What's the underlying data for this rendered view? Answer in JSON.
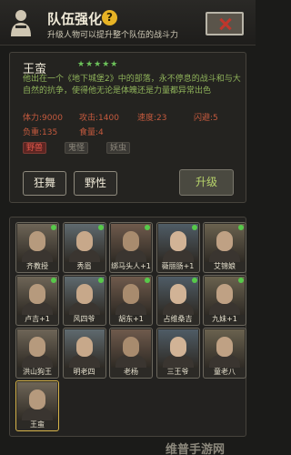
{
  "header": {
    "title": "队伍强化",
    "subtitle": "升级人物可以提升整个队伍的战斗力",
    "help": "?"
  },
  "hero": {
    "name": "王蛮",
    "stars": "★★★★★",
    "description": "他出在一个《地下城堡2》中的部落，永不停息的战斗和与大自然的抗争，使得他无论是体魄还是力量都异常出色",
    "stats": {
      "hp_label": "体力:",
      "hp": "9000",
      "atk_label": "攻击:",
      "atk": "1400",
      "spd_label": "速度:",
      "spd": "23",
      "dodge_label": "闪避:",
      "dodge": "5",
      "load_label": "负重:",
      "load": "135",
      "food_label": "食量:",
      "food": "4"
    },
    "tags": [
      "野兽",
      "鬼怪",
      "妖虫"
    ],
    "buttons": {
      "frenzy": "狂舞",
      "wild": "野性",
      "upgrade": "升级"
    }
  },
  "roster": {
    "members": [
      {
        "name": "齐教授",
        "dot": true
      },
      {
        "name": "秀眉",
        "dot": true
      },
      {
        "name": "绑马头人+1",
        "dot": true
      },
      {
        "name": "薇丽肠+1",
        "dot": true
      },
      {
        "name": "艾锦娘",
        "dot": true
      },
      {
        "name": "卢吉+1",
        "dot": true
      },
      {
        "name": "风四爷",
        "dot": true
      },
      {
        "name": "胡东+1",
        "dot": true
      },
      {
        "name": "占维桑吉",
        "dot": true
      },
      {
        "name": "九妹+1",
        "dot": true
      },
      {
        "name": "洪山狗王",
        "dot": false
      },
      {
        "name": "明老四",
        "dot": false
      },
      {
        "name": "老杨",
        "dot": false
      },
      {
        "name": "三王爷",
        "dot": false
      },
      {
        "name": "童老八",
        "dot": false
      },
      {
        "name": "王蛮",
        "dot": false
      }
    ]
  },
  "watermark": "维普手游网",
  "colors": {
    "accent_green": "#6cc15a",
    "stat_red": "#c55a3e",
    "help_yellow": "#e7b325",
    "close_red": "#c0362c"
  }
}
